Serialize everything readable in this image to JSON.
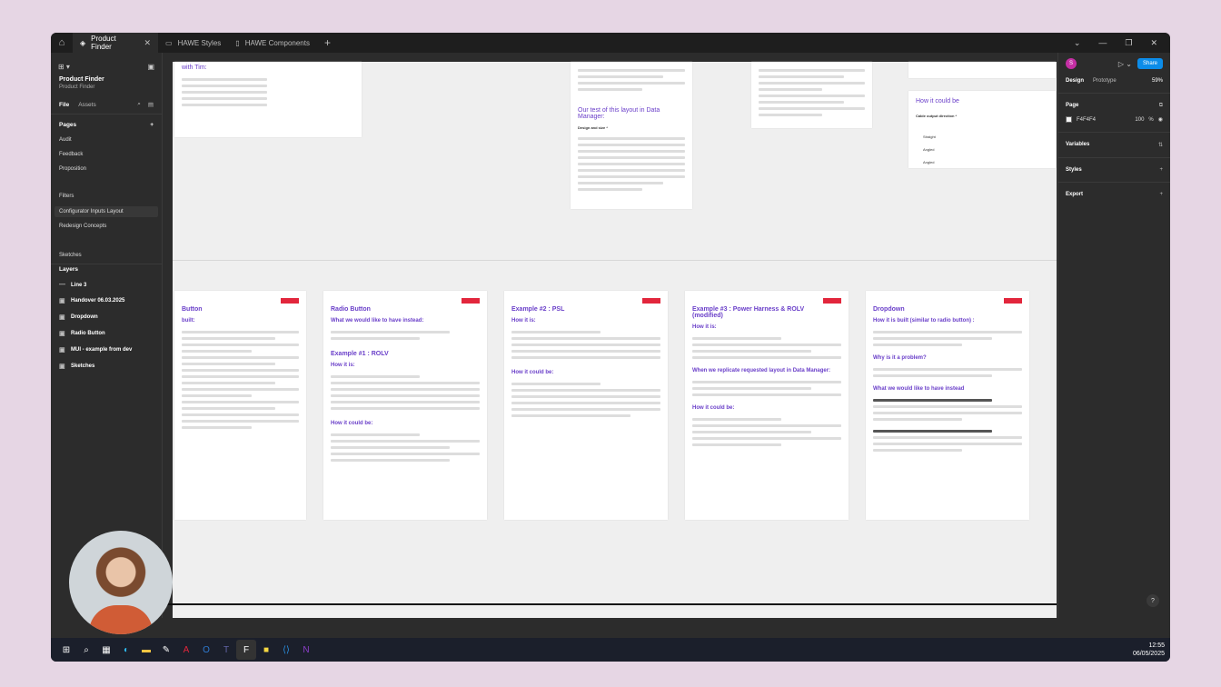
{
  "titlebar": {
    "tabs": [
      {
        "label": "Product Finder",
        "active": true
      },
      {
        "label": "HAWE Styles",
        "active": false
      },
      {
        "label": "HAWE Components",
        "active": false
      }
    ]
  },
  "left_panel": {
    "project_name": "Product Finder",
    "project_sub": "Product Finder",
    "tab_file": "File",
    "tab_assets": "Assets",
    "pages_title": "Pages",
    "pages": [
      "Audit",
      "Feedback",
      "Proposition",
      "Filters",
      "Configurator Inputs Layout",
      "Redesign Concepts",
      "Sketches"
    ],
    "active_page": "Configurator Inputs Layout",
    "layers_title": "Layers",
    "layers": [
      "Line 3",
      "Handover 06.03.2025",
      "Dropdown",
      "Radio Button",
      "MUI - example from dev",
      "Sketches"
    ]
  },
  "canvas": {
    "frames_top": [
      {
        "title": "with Tim:"
      },
      {
        "title": "Our test of this layout in Data Manager:",
        "label": "Design and size *"
      },
      {
        "title": ""
      },
      {
        "title": "How it could be",
        "label": "Cable output direction *",
        "options": [
          "Straight",
          "Angled",
          "Angled"
        ]
      }
    ],
    "frames_bottom": [
      {
        "title": "Button",
        "sub": "built:"
      },
      {
        "title": "Radio Button",
        "sub": "What we would like to have instead:",
        "sub2": "Example #1 : ROLV",
        "sub3": "How it is:",
        "sub4": "How it could be:"
      },
      {
        "title": "Example #2 : PSL",
        "sub": "How it is:",
        "sub2": "How it could be:"
      },
      {
        "title": "Example #3 : Power Harness & ROLV (modified)",
        "sub": "How it is:",
        "sub2": "When we replicate requested layout in Data Manager:",
        "sub3": "How it could be:"
      },
      {
        "title": "Dropdown",
        "sub": "How it is built (similar to radio button) :",
        "sub2": "Why is it a problem?",
        "sub3": "What we would like to have instead"
      }
    ]
  },
  "toolbar": {
    "tools": [
      "move-tool",
      "frame-tool",
      "shape-tool",
      "pen-tool",
      "text-tool",
      "comment-tool",
      "actions-tool",
      "dev-mode-tool"
    ]
  },
  "right_panel": {
    "avatar_letter": "S",
    "share_label": "Share",
    "tab_design": "Design",
    "tab_prototype": "Prototype",
    "zoom": "59%",
    "page_title": "Page",
    "page_color": "F4F4F4",
    "page_opacity": "100",
    "page_opacity_unit": "%",
    "variables": "Variables",
    "styles": "Styles",
    "export": "Export",
    "help": "?"
  },
  "taskbar": {
    "time": "12:55",
    "date": "06/05/2025"
  }
}
